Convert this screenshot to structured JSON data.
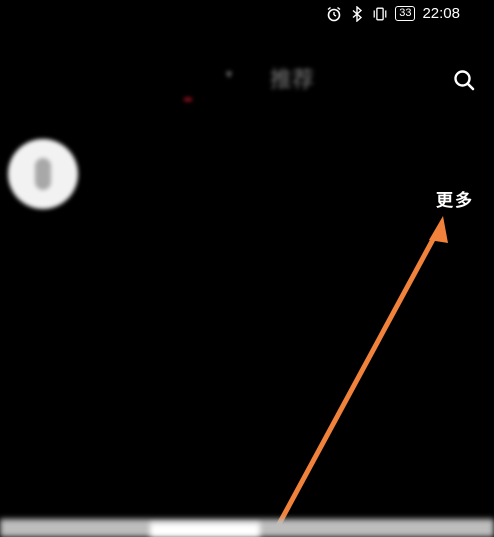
{
  "status_bar": {
    "carrier": "",
    "time": "22:08",
    "battery": "33",
    "icons": [
      "alarm-icon",
      "bluetooth-icon",
      "vibrate-icon",
      "battery-icon"
    ]
  },
  "tabs": [
    {
      "label": "",
      "active": true
    },
    {
      "label": "推荐",
      "active": false
    }
  ],
  "search": {
    "icon": "search-icon"
  },
  "avatar": {
    "label": ""
  },
  "more": {
    "label": "更多"
  },
  "annotation": {
    "color": "#f0823c",
    "points_to": "more"
  },
  "colors": {
    "background": "#000000",
    "active_indicator": "#c2152a"
  }
}
